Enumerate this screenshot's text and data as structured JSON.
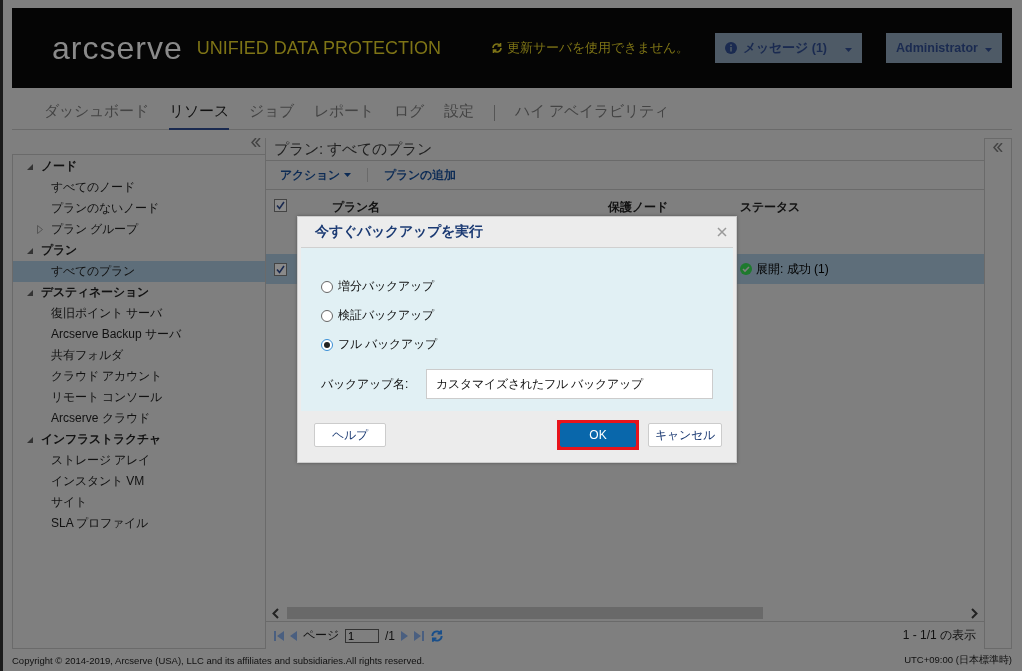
{
  "header": {
    "logo": "arcserve",
    "product": "UNIFIED DATA PROTECTION",
    "update_notice": "更新サーバを使用できません。",
    "messages_button": "メッセージ (1)",
    "user_button": "Administrator"
  },
  "nav": [
    {
      "kind": "tab",
      "label": "ダッシュボード",
      "selected": false
    },
    {
      "kind": "tab",
      "label": "リソース",
      "selected": true
    },
    {
      "kind": "tab",
      "label": "ジョブ",
      "selected": false
    },
    {
      "kind": "tab",
      "label": "レポート",
      "selected": false
    },
    {
      "kind": "tab",
      "label": "ログ",
      "selected": false
    },
    {
      "kind": "tab",
      "label": "設定",
      "selected": false
    },
    {
      "kind": "separator"
    },
    {
      "kind": "tab",
      "label": "ハイ アベイラビリティ",
      "selected": false
    }
  ],
  "sidebar": {
    "tree": [
      {
        "label": "ノード",
        "expanded": true,
        "selected": false,
        "children": [
          {
            "label": "すべてのノード",
            "selected": false
          },
          {
            "label": "プランのないノード",
            "selected": false
          },
          {
            "label": "プラン グループ",
            "expanded": false,
            "selected": false
          }
        ]
      },
      {
        "label": "プラン",
        "expanded": true,
        "selected": false,
        "children": [
          {
            "label": "すべてのプラン",
            "selected": true
          }
        ]
      },
      {
        "label": "デスティネーション",
        "expanded": true,
        "selected": false,
        "children": [
          {
            "label": "復旧ポイント サーバ",
            "selected": false
          },
          {
            "label": "Arcserve Backup サーバ",
            "selected": false
          },
          {
            "label": "共有フォルダ",
            "selected": false
          },
          {
            "label": "クラウド アカウント",
            "selected": false
          },
          {
            "label": "リモート コンソール",
            "selected": false
          },
          {
            "label": "Arcserve クラウド",
            "selected": false
          }
        ]
      },
      {
        "label": "インフラストラクチャ",
        "expanded": true,
        "selected": false,
        "children": [
          {
            "label": "ストレージ アレイ",
            "selected": false
          },
          {
            "label": "インスタント VM",
            "selected": false
          },
          {
            "label": "サイト",
            "selected": false
          },
          {
            "label": "SLA プロファイル",
            "selected": false
          }
        ]
      }
    ]
  },
  "main": {
    "title": "プラン: すべてのプラン",
    "toolbar": [
      "アクション",
      "プランの追加"
    ],
    "table": {
      "all_checked": true,
      "columns": [
        "プラン名",
        "保護ノード",
        "ステータス"
      ],
      "rows": [
        {
          "checked": true,
          "selected": true,
          "status": "展開: 成功 (1)"
        }
      ]
    },
    "pager": {
      "page_label": "ページ",
      "page_value": "1",
      "page_total": "/1",
      "summary": "1 - 1/1 の表示"
    }
  },
  "footer": {
    "copyright": "Copyright © 2014-2019, Arcserve (USA), LLC and its affiliates and subsidiaries.All rights reserved.",
    "timezone": "UTC+09:00 (日本標準時)"
  },
  "dialog": {
    "title": "今すぐバックアップを実行",
    "options": [
      {
        "label": "増分バックアップ",
        "selected": false
      },
      {
        "label": "検証バックアップ",
        "selected": false
      },
      {
        "label": "フル バックアップ",
        "selected": true
      }
    ],
    "name_label": "バックアップ名:",
    "name_value": "カスタマイズされたフル バックアップ",
    "buttons": [
      {
        "kind": "help",
        "label": "ヘルプ",
        "highlighted": false
      },
      {
        "kind": "ok",
        "label": "OK",
        "highlighted": true
      },
      {
        "kind": "cancel",
        "label": "キャンセル",
        "highlighted": false
      }
    ]
  }
}
